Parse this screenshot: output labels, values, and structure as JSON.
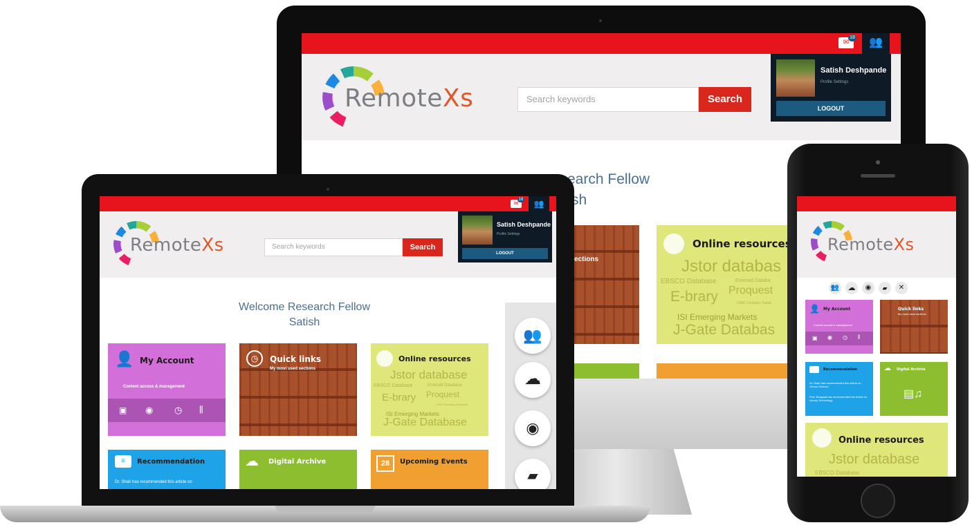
{
  "app": {
    "logo_prefix": "Remote",
    "logo_suffix": "Xs",
    "search_placeholder": "Search keywords",
    "search_button": "Search",
    "mail_count": "18",
    "user_name": "Satish Deshpande",
    "profile_link": "Profile Settings",
    "logout_label": "LOGOUT",
    "welcome_line1": "Welcome Research Fellow",
    "welcome_line2": "Satish",
    "welcome_partial_line1": "earch Fellow",
    "welcome_partial_line2": "sh"
  },
  "tiles": {
    "my_account": {
      "title": "My Account",
      "subtitle": "Content access & management"
    },
    "quick_links": {
      "title": "Quick links",
      "subtitle": "My most used sections",
      "subtitle_partial": "ections"
    },
    "online_resources": {
      "title": "Online resources",
      "words": [
        "Jstor database",
        "EBSCO Database",
        "Emerald Database",
        "E-brary",
        "Proquest",
        "CMIE Company Database",
        "ISI Emerging Markets",
        "J-Gate Database"
      ],
      "desktop_words": [
        "Jstor databas",
        "EBSCO Database",
        "Emerald Databa",
        "E-brary",
        "Proquest",
        "CMIE Company Datab",
        "ISI Emerging Markets",
        "J-Gate Databas"
      ]
    },
    "recommendation": {
      "title": "Recommendation",
      "text": "Dr. Shah has recommended this article on",
      "phone_text_1": "Dr. Shah has recommended this article on Library Science",
      "phone_text_2": "Prof. Bhagwat has recommended the article on Library Technology"
    },
    "digital_archive": {
      "title": "Digital Archive"
    },
    "upcoming_events": {
      "title": "Upcoming Events",
      "date": "28"
    }
  },
  "icons": {
    "side_dock": [
      "users-icon",
      "cloud-icon",
      "eye-icon",
      "folder-icon"
    ],
    "account_actions": [
      "folder-lock-icon",
      "eye-icon",
      "clock-icon",
      "equalizer-icon"
    ],
    "phone_nav": [
      "users-icon",
      "cloud-icon",
      "eye-icon",
      "folder-icon",
      "tools-icon"
    ]
  },
  "colors": {
    "red": "#e8141b",
    "search": "#d9271d",
    "purple": "#d36fd8",
    "lime": "#dfe67a",
    "blue": "#1ea3e8",
    "green": "#8dbe2f",
    "orange": "#f0a030",
    "welcome": "#4a6f93"
  }
}
